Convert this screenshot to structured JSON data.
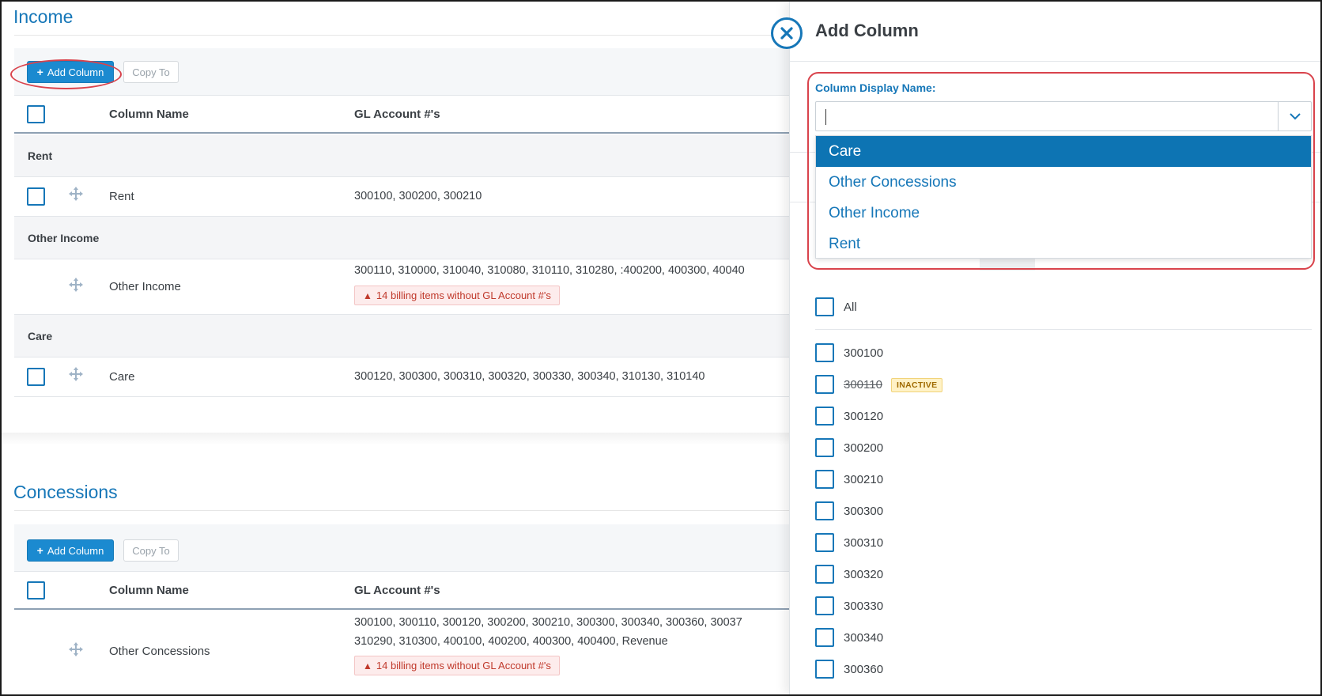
{
  "income": {
    "title": "Income",
    "add_label": "Add Column",
    "copy_label": "Copy To",
    "columns": {
      "name": "Column Name",
      "gl": "GL Account #'s"
    },
    "groups": [
      {
        "label": "Rent",
        "row_name": "Rent",
        "row_gl": "300100, 300200, 300210"
      },
      {
        "label": "Other Income",
        "row_name": "Other Income",
        "row_gl": "300110, 310000, 310040, 310080, 310110, 310280, :400200, 400300, 40040",
        "warning": "14 billing items without GL Account #'s"
      },
      {
        "label": "Care",
        "row_name": "Care",
        "row_gl": "300120, 300300, 300310, 300320, 300330, 300340,  310130, 310140"
      }
    ]
  },
  "concessions": {
    "title": "Concessions",
    "add_label": "Add Column",
    "copy_label": "Copy To",
    "columns": {
      "name": "Column Name",
      "gl": "GL Account #'s"
    },
    "row_name": "Other Concessions",
    "row_gl_line1": "300100, 300110, 300120, 300200, 300210, 300300,  300340, 300360, 30037",
    "row_gl_line2": "310290, 310300, 400100, 400200, 400300, 400400,  Revenue",
    "warning": "14 billing items without GL Account #'s"
  },
  "panel": {
    "title": "Add Column",
    "field_label": "Column Display Name:",
    "input_value": "",
    "options": [
      "Care",
      "Other Concessions",
      "Other Income",
      "Rent"
    ],
    "selected_option": "Care",
    "all_label": "All",
    "accounts": [
      {
        "code": "300100"
      },
      {
        "code": "300110",
        "badge": "INACTIVE"
      },
      {
        "code": "300120"
      },
      {
        "code": "300200"
      },
      {
        "code": "300210"
      },
      {
        "code": "300300"
      },
      {
        "code": "300310"
      },
      {
        "code": "300320"
      },
      {
        "code": "300330"
      },
      {
        "code": "300340"
      },
      {
        "code": "300360"
      }
    ]
  },
  "colors": {
    "accent": "#1677b8",
    "button": "#1b8ad0",
    "selected": "#0d74b3",
    "highlight": "#d9434c",
    "warning_text": "#c0392b",
    "inactive_bg": "#fff2c6"
  },
  "icons": {
    "drag": "drag-handle-icon",
    "close": "close-icon",
    "chevron": "chevron-down-icon",
    "warning": "warning-triangle-icon",
    "plus": "plus-icon"
  }
}
